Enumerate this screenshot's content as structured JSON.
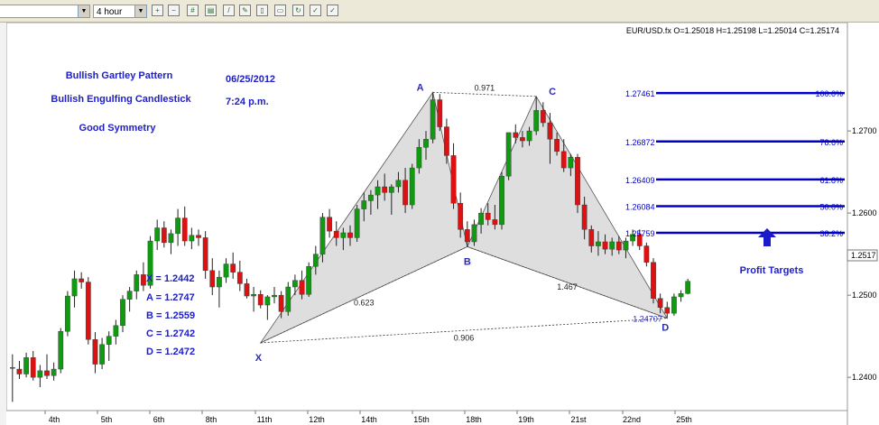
{
  "toolbar": {
    "symbol_select": {
      "value": ""
    },
    "timeframe_select": {
      "value": "4 hour"
    },
    "period_select": {
      "value": ""
    },
    "icons": [
      "zoom-in-icon",
      "zoom-out-icon",
      "grid-icon",
      "chart-type-icon",
      "draw-line-icon",
      "edit-icon",
      "page-icon",
      "print-icon",
      "refresh-icon",
      "settings-icon"
    ]
  },
  "chart_data": {
    "type": "candlestick",
    "header": "EUR/USD.fx O=1.25018 H=1.25198 L=1.25014 C=1.25174",
    "current_price": "1.2517",
    "y_ticks": [
      "1.2700",
      "1.2600",
      "1.2500",
      "1.2400"
    ],
    "y_tick_values": [
      1.27,
      1.26,
      1.25,
      1.24
    ],
    "ylim": [
      1.2365,
      1.281
    ],
    "x_ticks": [
      "4th",
      "5th",
      "6th",
      "8th",
      "11th",
      "12th",
      "14th",
      "15th",
      "18th",
      "19th",
      "21st",
      "22nd",
      "25th"
    ],
    "colors": {
      "bull": "#129912",
      "bear": "#dd1111",
      "pattern_fill": "#d8d8d8",
      "fib_line": "#0000cc",
      "label": "#2020c8"
    },
    "candles": [
      {
        "o": 1.2412,
        "h": 1.2428,
        "l": 1.237,
        "c": 1.2412
      },
      {
        "o": 1.241,
        "h": 1.242,
        "l": 1.2398,
        "c": 1.2404
      },
      {
        "o": 1.2404,
        "h": 1.243,
        "l": 1.24,
        "c": 1.2424
      },
      {
        "o": 1.2424,
        "h": 1.2432,
        "l": 1.2396,
        "c": 1.24
      },
      {
        "o": 1.24,
        "h": 1.2415,
        "l": 1.2388,
        "c": 1.2408
      },
      {
        "o": 1.2408,
        "h": 1.2428,
        "l": 1.2398,
        "c": 1.2402
      },
      {
        "o": 1.2402,
        "h": 1.2418,
        "l": 1.2396,
        "c": 1.241
      },
      {
        "o": 1.241,
        "h": 1.246,
        "l": 1.2405,
        "c": 1.2456
      },
      {
        "o": 1.2456,
        "h": 1.2505,
        "l": 1.245,
        "c": 1.2499
      },
      {
        "o": 1.2499,
        "h": 1.253,
        "l": 1.2485,
        "c": 1.252
      },
      {
        "o": 1.252,
        "h": 1.2528,
        "l": 1.2508,
        "c": 1.2516
      },
      {
        "o": 1.2516,
        "h": 1.2522,
        "l": 1.244,
        "c": 1.2446
      },
      {
        "o": 1.2446,
        "h": 1.2455,
        "l": 1.2405,
        "c": 1.2416
      },
      {
        "o": 1.2416,
        "h": 1.2448,
        "l": 1.241,
        "c": 1.244
      },
      {
        "o": 1.244,
        "h": 1.2456,
        "l": 1.242,
        "c": 1.245
      },
      {
        "o": 1.245,
        "h": 1.247,
        "l": 1.244,
        "c": 1.2463
      },
      {
        "o": 1.2463,
        "h": 1.25,
        "l": 1.2455,
        "c": 1.2495
      },
      {
        "o": 1.2495,
        "h": 1.251,
        "l": 1.248,
        "c": 1.2505
      },
      {
        "o": 1.2505,
        "h": 1.253,
        "l": 1.2495,
        "c": 1.2525
      },
      {
        "o": 1.2525,
        "h": 1.254,
        "l": 1.2505,
        "c": 1.2512
      },
      {
        "o": 1.2512,
        "h": 1.2572,
        "l": 1.2508,
        "c": 1.2566
      },
      {
        "o": 1.2566,
        "h": 1.2592,
        "l": 1.2555,
        "c": 1.2582
      },
      {
        "o": 1.2582,
        "h": 1.259,
        "l": 1.2558,
        "c": 1.2564
      },
      {
        "o": 1.2564,
        "h": 1.258,
        "l": 1.255,
        "c": 1.2575
      },
      {
        "o": 1.2575,
        "h": 1.2605,
        "l": 1.256,
        "c": 1.2594
      },
      {
        "o": 1.2594,
        "h": 1.2608,
        "l": 1.256,
        "c": 1.2566
      },
      {
        "o": 1.2566,
        "h": 1.2582,
        "l": 1.2556,
        "c": 1.2573
      },
      {
        "o": 1.2573,
        "h": 1.258,
        "l": 1.256,
        "c": 1.257
      },
      {
        "o": 1.257,
        "h": 1.2578,
        "l": 1.252,
        "c": 1.253
      },
      {
        "o": 1.253,
        "h": 1.2545,
        "l": 1.25,
        "c": 1.251
      },
      {
        "o": 1.251,
        "h": 1.253,
        "l": 1.2485,
        "c": 1.2522
      },
      {
        "o": 1.2522,
        "h": 1.2545,
        "l": 1.2515,
        "c": 1.2538
      },
      {
        "o": 1.2538,
        "h": 1.2552,
        "l": 1.252,
        "c": 1.2528
      },
      {
        "o": 1.2528,
        "h": 1.2542,
        "l": 1.2505,
        "c": 1.2514
      },
      {
        "o": 1.2514,
        "h": 1.252,
        "l": 1.2496,
        "c": 1.2499
      },
      {
        "o": 1.2499,
        "h": 1.251,
        "l": 1.248,
        "c": 1.2501
      },
      {
        "o": 1.2501,
        "h": 1.2506,
        "l": 1.2484,
        "c": 1.2488
      },
      {
        "o": 1.2488,
        "h": 1.25,
        "l": 1.247,
        "c": 1.2498
      },
      {
        "o": 1.2498,
        "h": 1.251,
        "l": 1.249,
        "c": 1.25
      },
      {
        "o": 1.25,
        "h": 1.2505,
        "l": 1.2472,
        "c": 1.248
      },
      {
        "o": 1.248,
        "h": 1.2516,
        "l": 1.2475,
        "c": 1.251
      },
      {
        "o": 1.251,
        "h": 1.2525,
        "l": 1.25,
        "c": 1.2518
      },
      {
        "o": 1.2518,
        "h": 1.253,
        "l": 1.2495,
        "c": 1.2501
      },
      {
        "o": 1.2501,
        "h": 1.254,
        "l": 1.2498,
        "c": 1.2535
      },
      {
        "o": 1.2535,
        "h": 1.256,
        "l": 1.2525,
        "c": 1.255
      },
      {
        "o": 1.255,
        "h": 1.26,
        "l": 1.254,
        "c": 1.2595
      },
      {
        "o": 1.2595,
        "h": 1.2605,
        "l": 1.257,
        "c": 1.2578
      },
      {
        "o": 1.2578,
        "h": 1.259,
        "l": 1.256,
        "c": 1.257
      },
      {
        "o": 1.257,
        "h": 1.2582,
        "l": 1.2555,
        "c": 1.2576
      },
      {
        "o": 1.2576,
        "h": 1.2585,
        "l": 1.256,
        "c": 1.257
      },
      {
        "o": 1.257,
        "h": 1.261,
        "l": 1.2565,
        "c": 1.2605
      },
      {
        "o": 1.2605,
        "h": 1.2625,
        "l": 1.259,
        "c": 1.2615
      },
      {
        "o": 1.2615,
        "h": 1.2628,
        "l": 1.2598,
        "c": 1.2622
      },
      {
        "o": 1.2622,
        "h": 1.264,
        "l": 1.2605,
        "c": 1.2632
      },
      {
        "o": 1.2632,
        "h": 1.2648,
        "l": 1.2615,
        "c": 1.2625
      },
      {
        "o": 1.2625,
        "h": 1.2635,
        "l": 1.2598,
        "c": 1.2632
      },
      {
        "o": 1.2632,
        "h": 1.265,
        "l": 1.2625,
        "c": 1.264
      },
      {
        "o": 1.264,
        "h": 1.2655,
        "l": 1.26,
        "c": 1.261
      },
      {
        "o": 1.261,
        "h": 1.266,
        "l": 1.2605,
        "c": 1.2655
      },
      {
        "o": 1.2655,
        "h": 1.269,
        "l": 1.2648,
        "c": 1.268
      },
      {
        "o": 1.268,
        "h": 1.27,
        "l": 1.2665,
        "c": 1.269
      },
      {
        "o": 1.269,
        "h": 1.2747,
        "l": 1.2685,
        "c": 1.2738
      },
      {
        "o": 1.2738,
        "h": 1.2745,
        "l": 1.27,
        "c": 1.2705
      },
      {
        "o": 1.2705,
        "h": 1.2715,
        "l": 1.266,
        "c": 1.267
      },
      {
        "o": 1.267,
        "h": 1.2685,
        "l": 1.2605,
        "c": 1.2612
      },
      {
        "o": 1.2612,
        "h": 1.2625,
        "l": 1.257,
        "c": 1.258
      },
      {
        "o": 1.258,
        "h": 1.259,
        "l": 1.2559,
        "c": 1.2565
      },
      {
        "o": 1.2565,
        "h": 1.2592,
        "l": 1.256,
        "c": 1.2586
      },
      {
        "o": 1.2586,
        "h": 1.2606,
        "l": 1.2575,
        "c": 1.26
      },
      {
        "o": 1.26,
        "h": 1.2612,
        "l": 1.2585,
        "c": 1.2592
      },
      {
        "o": 1.2592,
        "h": 1.261,
        "l": 1.258,
        "c": 1.2586
      },
      {
        "o": 1.2586,
        "h": 1.265,
        "l": 1.258,
        "c": 1.2645
      },
      {
        "o": 1.2645,
        "h": 1.2685,
        "l": 1.264,
        "c": 1.2698
      },
      {
        "o": 1.2698,
        "h": 1.2708,
        "l": 1.2685,
        "c": 1.2692
      },
      {
        "o": 1.2692,
        "h": 1.27,
        "l": 1.268,
        "c": 1.2688
      },
      {
        "o": 1.2688,
        "h": 1.2705,
        "l": 1.2682,
        "c": 1.27
      },
      {
        "o": 1.27,
        "h": 1.2742,
        "l": 1.2695,
        "c": 1.2725
      },
      {
        "o": 1.2725,
        "h": 1.2735,
        "l": 1.2705,
        "c": 1.271
      },
      {
        "o": 1.271,
        "h": 1.2722,
        "l": 1.266,
        "c": 1.269
      },
      {
        "o": 1.269,
        "h": 1.2698,
        "l": 1.267,
        "c": 1.2675
      },
      {
        "o": 1.2675,
        "h": 1.269,
        "l": 1.265,
        "c": 1.2655
      },
      {
        "o": 1.2655,
        "h": 1.2672,
        "l": 1.2645,
        "c": 1.2668
      },
      {
        "o": 1.2668,
        "h": 1.2672,
        "l": 1.26,
        "c": 1.261
      },
      {
        "o": 1.261,
        "h": 1.262,
        "l": 1.2568,
        "c": 1.258
      },
      {
        "o": 1.258,
        "h": 1.2585,
        "l": 1.2552,
        "c": 1.256
      },
      {
        "o": 1.256,
        "h": 1.2578,
        "l": 1.2548,
        "c": 1.2565
      },
      {
        "o": 1.2565,
        "h": 1.2574,
        "l": 1.255,
        "c": 1.2556
      },
      {
        "o": 1.2556,
        "h": 1.257,
        "l": 1.2548,
        "c": 1.2565
      },
      {
        "o": 1.2565,
        "h": 1.2572,
        "l": 1.255,
        "c": 1.2555
      },
      {
        "o": 1.2555,
        "h": 1.257,
        "l": 1.2545,
        "c": 1.2566
      },
      {
        "o": 1.2566,
        "h": 1.258,
        "l": 1.256,
        "c": 1.2574
      },
      {
        "o": 1.2574,
        "h": 1.258,
        "l": 1.2555,
        "c": 1.256
      },
      {
        "o": 1.256,
        "h": 1.2564,
        "l": 1.2535,
        "c": 1.254
      },
      {
        "o": 1.254,
        "h": 1.2545,
        "l": 1.249,
        "c": 1.2496
      },
      {
        "o": 1.2496,
        "h": 1.2502,
        "l": 1.2478,
        "c": 1.2485
      },
      {
        "o": 1.2485,
        "h": 1.2492,
        "l": 1.2472,
        "c": 1.2478
      },
      {
        "o": 1.2478,
        "h": 1.2502,
        "l": 1.2475,
        "c": 1.2498
      },
      {
        "o": 1.2498,
        "h": 1.2506,
        "l": 1.2492,
        "c": 1.2502
      },
      {
        "o": 1.2502,
        "h": 1.252,
        "l": 1.2501,
        "c": 1.2517
      }
    ],
    "pattern": {
      "points": [
        {
          "name": "X",
          "idx": 36,
          "price": 1.2442
        },
        {
          "name": "A",
          "idx": 61,
          "price": 1.2747
        },
        {
          "name": "B",
          "idx": 66,
          "price": 1.2559
        },
        {
          "name": "C",
          "idx": 76,
          "price": 1.2742
        },
        {
          "name": "D",
          "idx": 95,
          "price": 1.2472
        }
      ],
      "ratios": [
        {
          "label": "0.971",
          "between": [
            "A",
            "C"
          ]
        },
        {
          "label": "0.623",
          "between": [
            "X",
            "B"
          ]
        },
        {
          "label": "1.467",
          "between": [
            "B",
            "D"
          ]
        },
        {
          "label": "0.906",
          "between": [
            "X",
            "D"
          ]
        }
      ],
      "d_price_label": "1.24707"
    },
    "fib_levels": [
      {
        "price": 1.27461,
        "label": "1.27461",
        "pct": "100.0%"
      },
      {
        "price": 1.26872,
        "label": "1.26872",
        "pct": "78.6%"
      },
      {
        "price": 1.26409,
        "label": "1.26409",
        "pct": "61.8%"
      },
      {
        "price": 1.26084,
        "label": "1.26084",
        "pct": "50.0%"
      },
      {
        "price": 1.25759,
        "label": "1.25759",
        "pct": "38.2%"
      }
    ],
    "annotations": {
      "title1": "Bullish Gartley Pattern",
      "title2": "Bullish Engulfing Candlestick",
      "title3": "Good Symmetry",
      "date": "06/25/2012",
      "time": "7:24 p.m.",
      "levels": [
        "X = 1.2442",
        "A = 1.2747",
        "B = 1.2559",
        "C = 1.2742",
        "D = 1.2472"
      ],
      "profit_targets": "Profit Targets"
    }
  }
}
